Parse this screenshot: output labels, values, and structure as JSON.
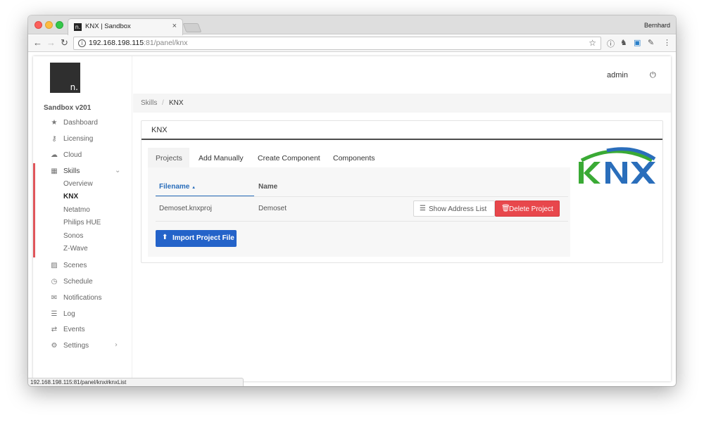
{
  "browser": {
    "tab_title": "KNX | Sandbox",
    "tab_favicon": "n.",
    "tab_close": "×",
    "profile_name": "Bernhard",
    "url_host": "192.168.198.115",
    "url_rest": ":81/panel/knx",
    "status_url": "192.168.198.115:81/panel/knx#knxList"
  },
  "app": {
    "logo_text": "n.",
    "brand": "Sandbox v201",
    "user": "admin"
  },
  "sidebar": {
    "items": [
      {
        "label": "Dashboard",
        "icon": "star-icon"
      },
      {
        "label": "Licensing",
        "icon": "key-icon"
      },
      {
        "label": "Cloud",
        "icon": "cloud-icon"
      },
      {
        "label": "Skills",
        "icon": "grid-icon"
      },
      {
        "label": "Scenes",
        "icon": "image-icon"
      },
      {
        "label": "Schedule",
        "icon": "clock-icon"
      },
      {
        "label": "Notifications",
        "icon": "envelope-icon"
      },
      {
        "label": "Log",
        "icon": "list-icon"
      },
      {
        "label": "Events",
        "icon": "exchange-icon"
      },
      {
        "label": "Settings",
        "icon": "gear-icon"
      }
    ],
    "skills_sub": [
      "Overview",
      "KNX",
      "Netatmo",
      "Philips HUE",
      "Sonos",
      "Z-Wave"
    ]
  },
  "breadcrumb": {
    "parent": "Skills",
    "separator": "/",
    "current": "KNX"
  },
  "card": {
    "title": "KNX",
    "tabs": [
      "Projects",
      "Add Manually",
      "Create Component",
      "Components"
    ],
    "table": {
      "headers": [
        "Filename",
        "Name"
      ],
      "sort_indicator": "▲",
      "rows": [
        {
          "filename": "Demoset.knxproj",
          "name": "Demoset"
        }
      ]
    },
    "show_address_label": "Show Address List",
    "delete_label": "Delete Project",
    "import_label": "Import Project File"
  },
  "colors": {
    "accent_red": "#e8474c",
    "primary_blue": "#2463c9",
    "knx_green": "#3aaa35",
    "knx_blue": "#2a6ebb",
    "active_bar": "#e0565b"
  }
}
